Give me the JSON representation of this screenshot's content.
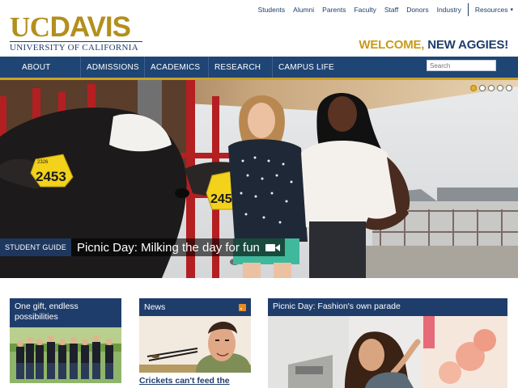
{
  "utility_nav": {
    "links": [
      "Students",
      "Alumni",
      "Parents",
      "Faculty",
      "Staff",
      "Donors",
      "Industry"
    ],
    "resources": "Resources"
  },
  "logo": {
    "uc": "UC",
    "davis": "DAVIS",
    "subtitle": "UNIVERSITY OF CALIFORNIA"
  },
  "welcome": {
    "part1": "WELCOME,",
    "part2": "NEW AGGIES!"
  },
  "main_nav": {
    "items": [
      "ABOUT",
      "ADMISSIONS",
      "ACADEMICS",
      "RESEARCH",
      "CAMPUS LIFE"
    ],
    "search_placeholder": "Search"
  },
  "hero": {
    "tag": "STUDENT GUIDE",
    "title": "Picnic Day: Milking the day for fun",
    "ear_tag_1": "2453",
    "ear_tag_1_small": "2326",
    "ear_tag_2": "2451",
    "slides_total": 5,
    "slide_active": 1
  },
  "cards": {
    "gift": {
      "title_line1": "One gift, endless",
      "title_line2": "possibilities"
    },
    "news": {
      "title": "News",
      "headline": "Crickets can't feed the"
    },
    "fashion": {
      "title": "Picnic Day: Fashion's own parade"
    }
  },
  "colors": {
    "navy": "#1f3d6b",
    "nav_bar": "#1f4575",
    "gold": "#c9a227",
    "logo_gold": "#b38f1c"
  },
  "icons": {
    "video": "video-camera-icon",
    "rss": "rss-icon",
    "dropdown": "chevron-down-icon"
  }
}
